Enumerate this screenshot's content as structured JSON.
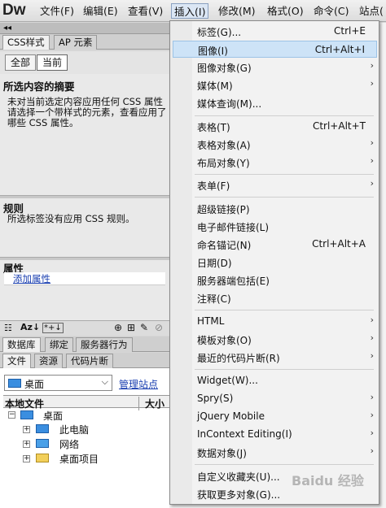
{
  "menubar": {
    "logo": "Dw",
    "items": [
      "文件(F)",
      "编辑(E)",
      "查看(V)",
      "插入(I)",
      "修改(M)",
      "格式(O)",
      "命令(C)",
      "站点("
    ]
  },
  "css_panel": {
    "tabs": [
      "CSS样式",
      "AP 元素"
    ],
    "buttons": [
      "全部",
      "当前"
    ],
    "summary_title": "所选内容的摘要",
    "summary_text": "未对当前选定内容应用任何 CSS 属性\n请选择一个带样式的元素，查看应用了\n哪些 CSS 属性。",
    "rules_title": "规则",
    "rules_text": "所选标签没有应用 CSS 规则。",
    "props_title": "属性",
    "add_property": "添加属性"
  },
  "files_panel": {
    "tabs_top": [
      "数据库",
      "绑定",
      "服务器行为"
    ],
    "tabs_bottom": [
      "文件",
      "资源",
      "代码片断"
    ],
    "site_select": "桌面",
    "manage_link": "管理站点",
    "col_local": "本地文件",
    "col_size": "大小",
    "tree": [
      "桌面",
      "此电脑",
      "网络",
      "桌面项目"
    ]
  },
  "insert_menu": {
    "items": [
      {
        "label": "标签(G)...",
        "shortcut": "Ctrl+E"
      },
      {
        "label": "图像(I)",
        "shortcut": "Ctrl+Alt+I"
      },
      {
        "label": "图像对象(G)",
        "sub": "›"
      },
      {
        "label": "媒体(M)",
        "sub": "›"
      },
      {
        "label": "媒体查询(M)..."
      },
      {
        "label": "表格(T)",
        "shortcut": "Ctrl+Alt+T"
      },
      {
        "label": "表格对象(A)",
        "sub": "›"
      },
      {
        "label": "布局对象(Y)",
        "sub": "›"
      },
      {
        "label": "表单(F)",
        "sub": "›"
      },
      {
        "label": "超级链接(P)"
      },
      {
        "label": "电子邮件链接(L)"
      },
      {
        "label": "命名锚记(N)",
        "shortcut": "Ctrl+Alt+A"
      },
      {
        "label": "日期(D)"
      },
      {
        "label": "服务器端包括(E)"
      },
      {
        "label": "注释(C)"
      },
      {
        "label": "HTML",
        "sub": "›"
      },
      {
        "label": "模板对象(O)",
        "sub": "›"
      },
      {
        "label": "最近的代码片断(R)",
        "sub": "›"
      },
      {
        "label": "Widget(W)..."
      },
      {
        "label": "Spry(S)",
        "sub": "›"
      },
      {
        "label": "jQuery Mobile",
        "sub": "›"
      },
      {
        "label": "InContext Editing(I)",
        "sub": "›"
      },
      {
        "label": "数据对象(J)",
        "sub": "›"
      },
      {
        "label": "自定义收藏夹(U)..."
      },
      {
        "label": "获取更多对象(G)..."
      }
    ]
  },
  "watermark": "Baidu 经验",
  "colors": {
    "highlight": "#cde3f7",
    "link": "#1a3fb0",
    "folder_icon": "#3a8ee0"
  }
}
